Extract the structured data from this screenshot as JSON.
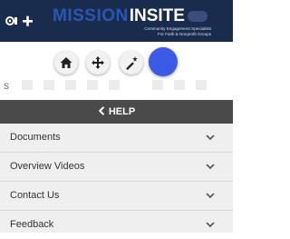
{
  "header": {
    "logo_mission": "MISSION",
    "logo_insite": "INSITE",
    "logo_tagline_1": "Community Engagement Specialists",
    "logo_tagline_2": "For Faith & Nonprofit Groups",
    "menu_icon": "settings-plus-icon"
  },
  "toolbar": {
    "tools": [
      {
        "name": "home",
        "icon": "home-icon"
      },
      {
        "name": "move",
        "icon": "move-arrows-icon"
      },
      {
        "name": "magic",
        "icon": "magic-wand-icon"
      },
      {
        "name": "color",
        "icon": "circle-icon",
        "color": "#3b5be6"
      }
    ],
    "label": "S"
  },
  "panel": {
    "title": "HELP",
    "back_icon": "chevron-left-icon",
    "items": [
      {
        "label": "Documents"
      },
      {
        "label": "Overview Videos"
      },
      {
        "label": "Contact Us"
      },
      {
        "label": "Feedback"
      }
    ]
  },
  "colors": {
    "header_bg": "#1a2c4e",
    "panel_header_bg": "#4a4a4a",
    "item_bg": "#efefef",
    "accent_blue": "#3b5be6"
  }
}
